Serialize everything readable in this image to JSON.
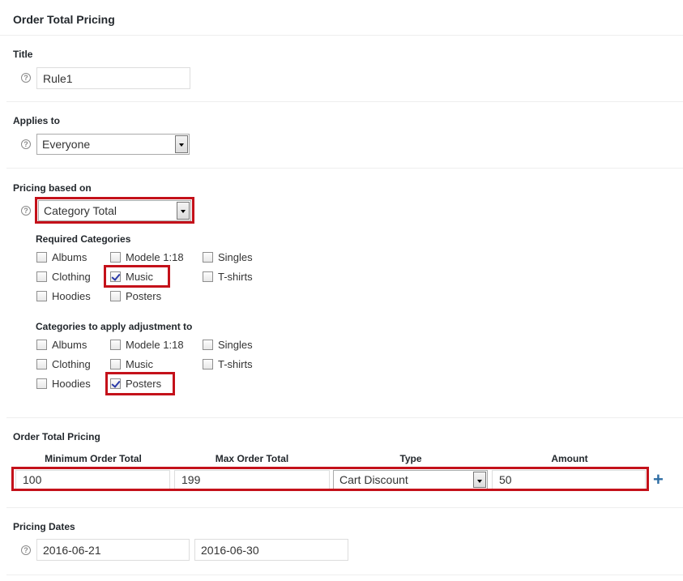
{
  "header": {
    "title": "Order Total Pricing"
  },
  "title_section": {
    "label": "Title",
    "value": "Rule1"
  },
  "applies_to": {
    "label": "Applies to",
    "selected": "Everyone"
  },
  "pricing_based_on": {
    "label": "Pricing based on",
    "selected": "Category Total",
    "required": {
      "label": "Required Categories",
      "items": [
        {
          "label": "Albums",
          "checked": false
        },
        {
          "label": "Modele 1:18",
          "checked": false
        },
        {
          "label": "Singles",
          "checked": false
        },
        {
          "label": "Clothing",
          "checked": false
        },
        {
          "label": "Music",
          "checked": true
        },
        {
          "label": "T-shirts",
          "checked": false
        },
        {
          "label": "Hoodies",
          "checked": false
        },
        {
          "label": "Posters",
          "checked": false
        }
      ]
    },
    "adjust": {
      "label": "Categories to apply adjustment to",
      "items": [
        {
          "label": "Albums",
          "checked": false
        },
        {
          "label": "Modele 1:18",
          "checked": false
        },
        {
          "label": "Singles",
          "checked": false
        },
        {
          "label": "Clothing",
          "checked": false
        },
        {
          "label": "Music",
          "checked": false
        },
        {
          "label": "T-shirts",
          "checked": false
        },
        {
          "label": "Hoodies",
          "checked": false
        },
        {
          "label": "Posters",
          "checked": true
        }
      ]
    }
  },
  "order_total": {
    "label": "Order Total Pricing",
    "columns": [
      "Minimum Order Total",
      "Max Order Total",
      "Type",
      "Amount"
    ],
    "row": {
      "min": "100",
      "max": "199",
      "type": "Cart Discount",
      "amount": "50"
    }
  },
  "pricing_dates": {
    "label": "Pricing Dates",
    "from": "2016-06-21",
    "to": "2016-06-30"
  },
  "icons": {
    "help": "help-icon",
    "add": "plus-icon"
  },
  "colors": {
    "highlight": "#c4111a",
    "accent": "#2e6da4"
  }
}
